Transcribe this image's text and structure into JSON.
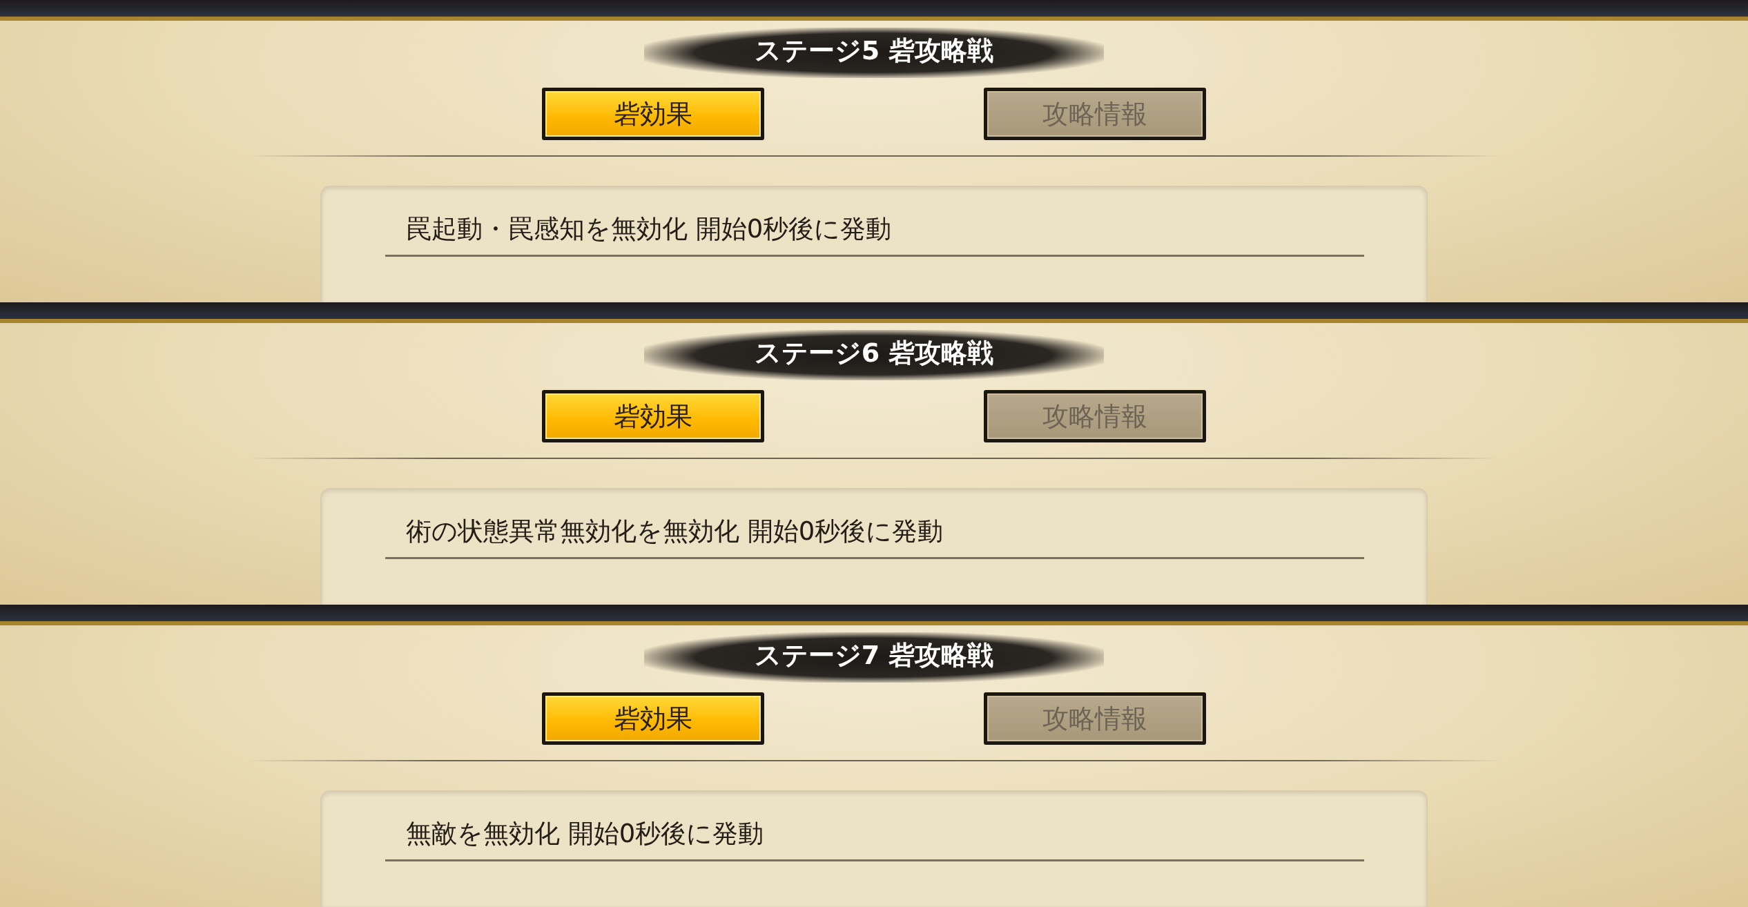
{
  "panels": [
    {
      "title": "ステージ5 砦攻略戦",
      "tabs": [
        {
          "label": "砦効果",
          "selected": true
        },
        {
          "label": "攻略情報",
          "selected": false
        }
      ],
      "effect": "罠起動・罠感知を無効化 開始0秒後に発動"
    },
    {
      "title": "ステージ6 砦攻略戦",
      "tabs": [
        {
          "label": "砦効果",
          "selected": true
        },
        {
          "label": "攻略情報",
          "selected": false
        }
      ],
      "effect": "術の状態異常無効化を無効化 開始0秒後に発動"
    },
    {
      "title": "ステージ7 砦攻略戦",
      "tabs": [
        {
          "label": "砦効果",
          "selected": true
        },
        {
          "label": "攻略情報",
          "selected": false
        }
      ],
      "effect": "無敵を無効化 開始0秒後に発動"
    }
  ]
}
